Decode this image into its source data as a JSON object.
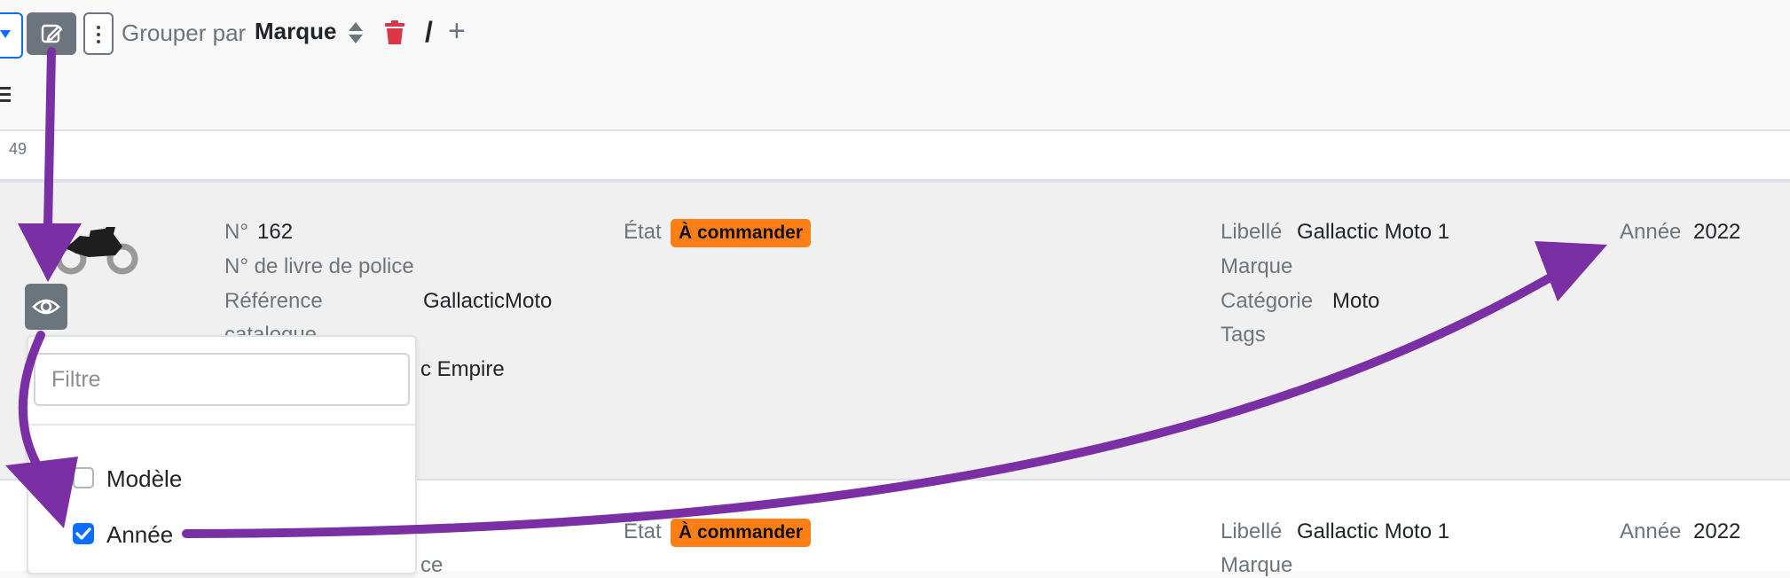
{
  "toolbar": {
    "group_by_label": "Grouper par",
    "group_by_value": "Marque",
    "slash": "/",
    "add": "+"
  },
  "list": {
    "count": "49"
  },
  "rows": [
    {
      "num_label": "N°",
      "num_value": "162",
      "police_book_label": "N° de livre de police",
      "reference_label": "Référence",
      "catalogue_label": "catalogue",
      "reference_value": "GallacticMoto",
      "supplier_partial": "c Empire",
      "state_label": "État",
      "state_badge": "À commander",
      "libelle_label": "Libellé",
      "libelle_value": "Gallactic Moto 1",
      "brand_label": "Marque",
      "category_label": "Catégorie",
      "category_value": "Moto",
      "tags_label": "Tags",
      "year_label": "Année",
      "year_value": "2022"
    },
    {
      "police_book_partial": "ce",
      "state_label": "État",
      "state_badge": "À commander",
      "libelle_label": "Libellé",
      "libelle_value": "Gallactic Moto 1",
      "brand_label": "Marque",
      "year_label": "Année",
      "year_value": "2022"
    }
  ],
  "column_picker": {
    "filter_placeholder": "Filtre",
    "options": [
      {
        "label": "Modèle",
        "checked": false
      },
      {
        "label": "Année",
        "checked": true
      }
    ]
  },
  "colors": {
    "badge": "#fd7e14",
    "annotation_arrow": "#7b2fa4",
    "delete": "#dc3545",
    "primary": "#0d6efd"
  },
  "icons": [
    "edit-icon",
    "more-vertical-icon",
    "sort-icon",
    "trash-icon",
    "menu-icon",
    "motorcycle-icon",
    "eye-icon",
    "check-icon"
  ]
}
